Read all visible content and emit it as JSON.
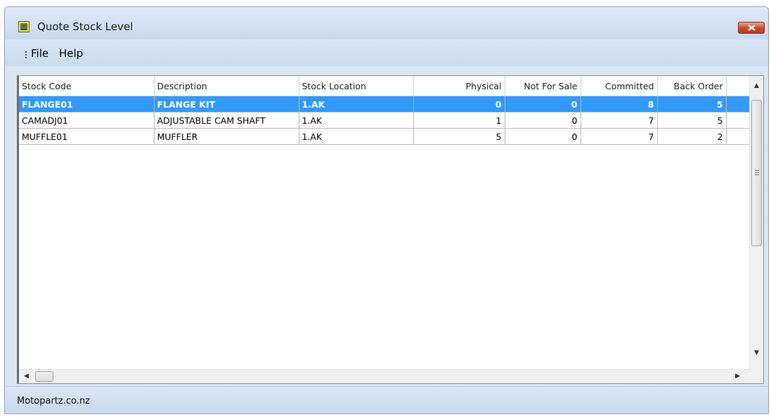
{
  "window": {
    "title": "Quote Stock Level"
  },
  "menu": {
    "items": [
      "File",
      "Help"
    ]
  },
  "grid": {
    "columns": [
      "Stock Code",
      "Description",
      "Stock Location",
      "Physical",
      "Not For Sale",
      "Committed",
      "Back Order"
    ],
    "rows": [
      {
        "stock_code": "FLANGE01",
        "description": "FLANGE KIT",
        "stock_location": "1.AK",
        "physical": "0",
        "not_for_sale": "0",
        "committed": "8",
        "back_order": "5",
        "selected": true
      },
      {
        "stock_code": "CAMADJ01",
        "description": "ADJUSTABLE CAM SHAFT",
        "stock_location": "1.AK",
        "physical": "1",
        "not_for_sale": "0",
        "committed": "7",
        "back_order": "5",
        "selected": false
      },
      {
        "stock_code": "MUFFLE01",
        "description": "MUFFLER",
        "stock_location": "1.AK",
        "physical": "5",
        "not_for_sale": "0",
        "committed": "7",
        "back_order": "2",
        "selected": false
      }
    ]
  },
  "status": {
    "text": "Motopartz.co.nz"
  },
  "colors": {
    "selection": "#3399ff",
    "close_button": "#c74a2f",
    "chrome": "#dbe6f3"
  },
  "icons": {
    "app": "app-icon",
    "close": "close-icon"
  }
}
